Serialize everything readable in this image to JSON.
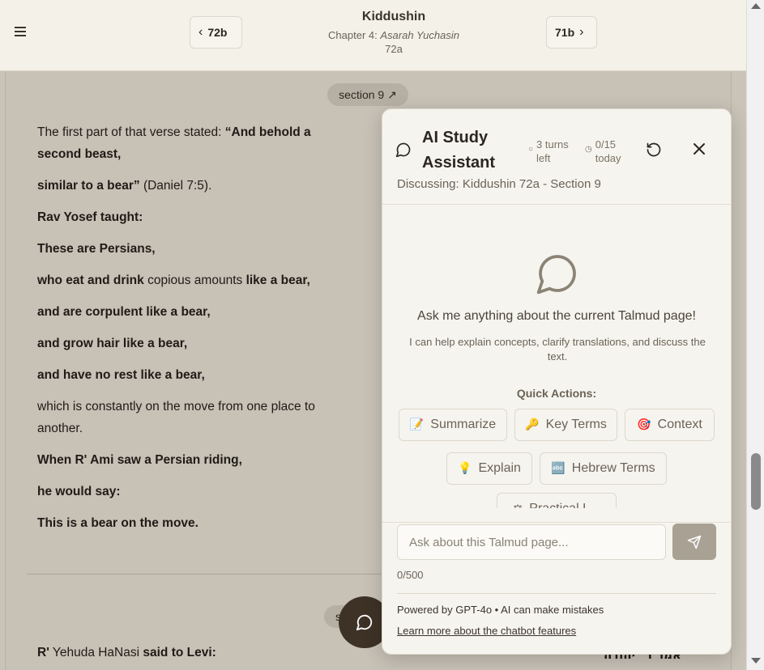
{
  "header": {
    "prev_label": "72b",
    "next_label": "71b",
    "title": "Kiddushin",
    "chapter_prefix": "Chapter 4: ",
    "chapter_name": "Asarah Yuchasin",
    "page": "72a"
  },
  "main": {
    "section_label": "section 9 ↗",
    "section_label_2": "s",
    "paragraphs": [
      {
        "parts": [
          {
            "t": "The first part of that verse stated: ",
            "b": false
          },
          {
            "t": "“And behold a second beast,",
            "b": true
          }
        ]
      },
      {
        "parts": [
          {
            "t": "similar to a bear”",
            "b": true
          },
          {
            "t": " (Daniel 7:5).",
            "b": false
          }
        ]
      },
      {
        "parts": [
          {
            "t": "Rav Yosef taught:",
            "b": true
          }
        ]
      },
      {
        "parts": [
          {
            "t": "These are Persians,",
            "b": true
          }
        ]
      },
      {
        "parts": [
          {
            "t": "who eat and drink",
            "b": true
          },
          {
            "t": " copious amounts ",
            "b": false
          },
          {
            "t": "like a bear,",
            "b": true
          }
        ]
      },
      {
        "parts": [
          {
            "t": "and are corpulent like a bear,",
            "b": true
          }
        ]
      },
      {
        "parts": [
          {
            "t": "and grow hair like a bear,",
            "b": true
          }
        ]
      },
      {
        "parts": [
          {
            "t": "and have no rest like a bear,",
            "b": true
          }
        ]
      },
      {
        "parts": [
          {
            "t": "which is constantly on the move from one place to another.",
            "b": false
          }
        ]
      },
      {
        "parts": [
          {
            "t": "When R' Ami saw a Persian riding,",
            "b": true
          }
        ]
      },
      {
        "parts": [
          {
            "t": "he would say:",
            "b": true
          }
        ]
      },
      {
        "parts": [
          {
            "t": "This is a bear on the move.",
            "b": true
          }
        ]
      }
    ],
    "bottom_line": [
      {
        "t": "R'",
        "b": true
      },
      {
        "t": " Yehuda HaNasi ",
        "b": false
      },
      {
        "t": "said to Levi:",
        "b": true
      }
    ],
    "bottom_hebrew": "אמר ר׳ יהודה"
  },
  "chat": {
    "title": "AI Study Assistant",
    "turns_count": "3 turns",
    "turns_left": "left",
    "quota_count": "0/15",
    "quota_period": "today",
    "discussing": "Discussing: Kiddushin 72a - Section 9",
    "ask_title": "Ask me anything about the current Talmud page!",
    "ask_sub": "I can help explain concepts, clarify translations, and discuss the text.",
    "quick_actions_title": "Quick Actions:",
    "quick_actions": [
      {
        "icon": "📝",
        "label": "Summarize"
      },
      {
        "icon": "🔑",
        "label": "Key Terms"
      },
      {
        "icon": "🎯",
        "label": "Context"
      },
      {
        "icon": "💡",
        "label": "Explain"
      },
      {
        "icon": "🔤",
        "label": "Hebrew Terms"
      },
      {
        "icon": "⚖",
        "label": "Practical L..."
      }
    ],
    "input_placeholder": "Ask about this Talmud page...",
    "counter": "0/500",
    "powered_by": "Powered by GPT-4o • AI can make mistakes",
    "learn_more": "Learn more about the chatbot features"
  },
  "colors": {
    "accent_dark": "#3e3226",
    "send_button": "#a8a194",
    "panel_bg": "#f6f4ee",
    "overlay_bg": "#c7c1b6"
  }
}
